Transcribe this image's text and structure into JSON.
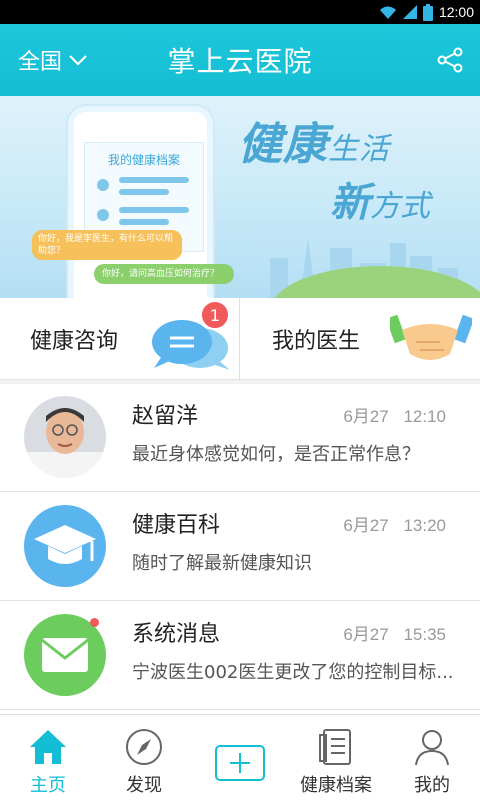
{
  "status_bar": {
    "time": "12:00",
    "icons": [
      "wifi-icon",
      "signal-icon",
      "battery-icon"
    ]
  },
  "app_bar": {
    "region": "全国",
    "title": "掌上云医院",
    "share_icon": "share-icon"
  },
  "banner": {
    "phone_card_title": "我的健康档案",
    "doctor_bubble": "你好，我是李医生，有什么可以帮助您？",
    "patient_bubble": "你好，请问高血压如何治疗？",
    "slogan_line1_big": "健康",
    "slogan_line1_small": "生活",
    "slogan_line2_big": "新",
    "slogan_line2_small": "方式"
  },
  "quick_actions": [
    {
      "label": "健康咨询",
      "icon": "chat-bubbles-icon",
      "badge": "1"
    },
    {
      "label": "我的医生",
      "icon": "handshake-icon"
    }
  ],
  "messages": [
    {
      "title": "赵留洋",
      "date": "6月27",
      "time": "12:10",
      "preview": "最近身体感觉如何，是否正常作息？",
      "icon": "doctor-avatar"
    },
    {
      "title": "健康百科",
      "date": "6月27",
      "time": "13:20",
      "preview": "随时了解最新健康知识",
      "icon": "graduation-cap-icon"
    },
    {
      "title": "系统消息",
      "date": "6月27",
      "time": "15:35",
      "preview": "宁波医生002医生更改了您的控制目标...",
      "icon": "envelope-icon"
    }
  ],
  "tabs": [
    {
      "label": "主页",
      "icon": "home-icon",
      "active": true
    },
    {
      "label": "发现",
      "icon": "compass-icon",
      "active": false
    },
    {
      "label": "",
      "icon": "add-icon",
      "active": false
    },
    {
      "label": "健康档案",
      "icon": "record-icon",
      "active": false
    },
    {
      "label": "我的",
      "icon": "user-icon",
      "active": false
    }
  ],
  "colors": {
    "primary": "#13bdd3",
    "accent_blue": "#5ab4ee",
    "accent_green": "#6ccc5e",
    "badge_red": "#f05a5a",
    "tab_inactive": "#666666"
  }
}
